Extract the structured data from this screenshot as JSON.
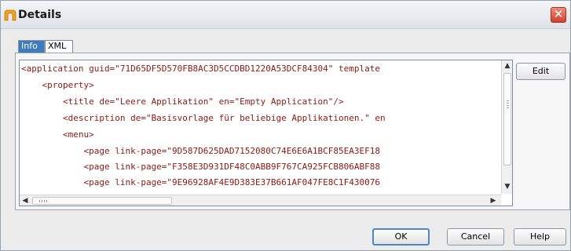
{
  "window": {
    "title": "Details",
    "close_glyph": "✕",
    "app_icon": "folder-arch-icon"
  },
  "tabs": [
    {
      "label": "Info",
      "active": false
    },
    {
      "label": "XML",
      "active": true
    }
  ],
  "editor": {
    "lines": [
      "<application guid=\"71D65DF5D570FB8AC3D5CCDBD1220A53DCF84304\" template",
      "    <property>",
      "        <title de=\"Leere Applikation\" en=\"Empty Application\"/>",
      "        <description de=\"Basisvorlage für beliebige Applikationen.\" en",
      "        <menu>",
      "            <page link-page=\"9D587D625DAD7152080C74E6E6A1BCF85EA3EF18",
      "            <page link-page=\"F358E3D931DF48C0ABB9F767CA925FCB806ABF88",
      "            <page link-page=\"9E96928AF4E9D383E37B661AF047FE8C1F430076"
    ],
    "text_color": "#8b1a12",
    "scroll_up": "▲",
    "scroll_down": "▼",
    "scroll_left": "◀",
    "scroll_right": "▶"
  },
  "buttons": {
    "edit": "Edit",
    "ok": "OK",
    "cancel": "Cancel",
    "help": "Help"
  },
  "colors": {
    "tab_active_bg": "#3e7bbf",
    "close_button": "#d2402d",
    "default_button_border": "#4f86c6"
  }
}
